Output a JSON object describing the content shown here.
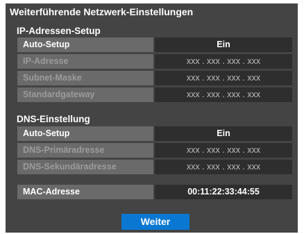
{
  "dialog": {
    "title": "Weiterführende Netzwerk-Einstellungen",
    "background": "#444444",
    "accent": "#0a78d2"
  },
  "ip_section": {
    "heading": "IP-Adressen-Setup",
    "auto_setup": {
      "label": "Auto-Setup",
      "value": "Ein"
    },
    "ip_address": {
      "label": "IP-Adresse",
      "value": "xxx . xxx . xxx . xxx"
    },
    "subnet_mask": {
      "label": "Subnet-Maske",
      "value": "xxx . xxx . xxx . xxx"
    },
    "gateway": {
      "label": "Standardgateway",
      "value": "xxx . xxx . xxx . xxx"
    }
  },
  "dns_section": {
    "heading": "DNS-Einstellung",
    "auto_setup": {
      "label": "Auto-Setup",
      "value": "Ein"
    },
    "primary": {
      "label": "DNS-Primäradresse",
      "value": "xxx . xxx . xxx . xxx"
    },
    "secondary": {
      "label": "DNS-Sekundäradresse",
      "value": "xxx . xxx . xxx . xxx"
    }
  },
  "mac": {
    "label": "MAC-Adresse",
    "value": "00:11:22:33:44:55"
  },
  "buttons": {
    "next_label": "Weiter"
  }
}
